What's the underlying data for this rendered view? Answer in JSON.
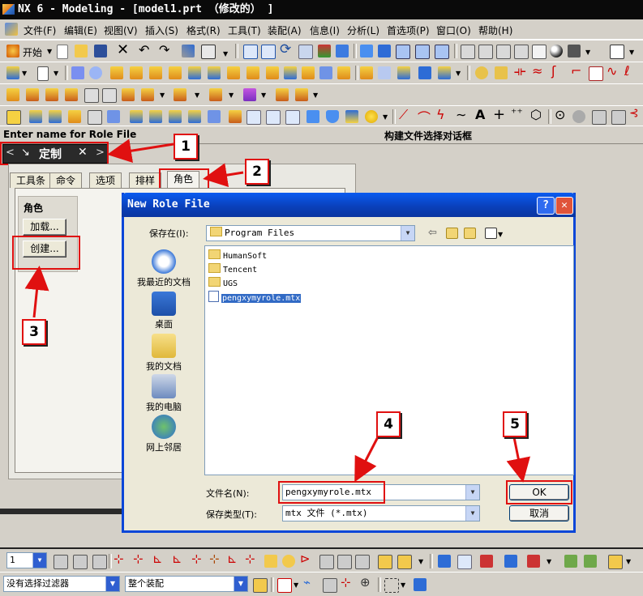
{
  "window": {
    "title": "NX 6 - Modeling - [model1.prt （修改的） ]"
  },
  "menu": [
    "文件(F)",
    "编辑(E)",
    "视图(V)",
    "插入(S)",
    "格式(R)",
    "工具(T)",
    "装配(A)",
    "信息(I)",
    "分析(L)",
    "首选项(P)",
    "窗口(O)",
    "帮助(H)"
  ],
  "toolbar": {
    "start_label": "开始"
  },
  "cue": {
    "prompt": "Enter name for Role File",
    "status": "构建文件选择对话框"
  },
  "resource_bar": {
    "title": "定制"
  },
  "customize_tabs": [
    "工具条",
    "命令",
    "选项",
    "排样",
    "角色"
  ],
  "role_group": {
    "title": "角色",
    "load_button": "加载...",
    "create_button": "创建..."
  },
  "callouts": [
    "1",
    "2",
    "3",
    "4",
    "5"
  ],
  "dialog": {
    "title": "New Role File",
    "save_in_label": "保存在(I):",
    "save_in_value": "Program Files",
    "places": [
      "我最近的文档",
      "桌面",
      "我的文档",
      "我的电脑",
      "网上邻居"
    ],
    "files": [
      {
        "name": "HumanSoft",
        "kind": "folder"
      },
      {
        "name": "Tencent",
        "kind": "folder"
      },
      {
        "name": "UGS",
        "kind": "folder"
      },
      {
        "name": "pengxymyrole.mtx",
        "kind": "file"
      }
    ],
    "filename_label": "文件名(N):",
    "filename_value": "pengxymyrole.mtx",
    "filetype_label": "保存类型(T):",
    "filetype_value": "mtx 文件 (*.mtx)",
    "ok_label": "OK",
    "cancel_label": "取消"
  },
  "bottom": {
    "layer_value": "1"
  },
  "status": {
    "filter_value": "没有选择过滤器",
    "scope_value": "整个装配"
  },
  "colors": {
    "callout_red": "#e01010",
    "dialog_blue": "#0a46d8",
    "selection": "#316ac5"
  }
}
